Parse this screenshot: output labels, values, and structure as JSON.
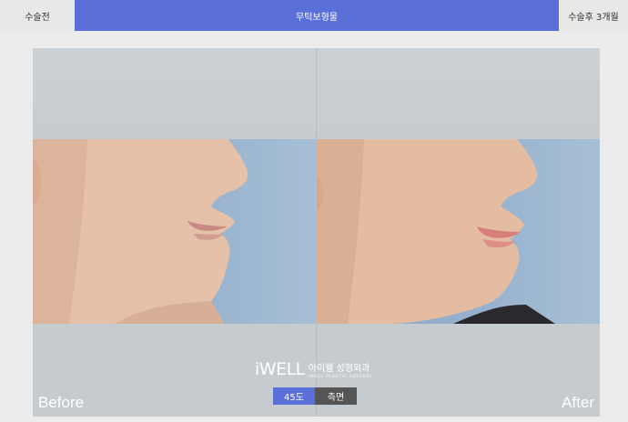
{
  "tabs": {
    "before": "수술전",
    "procedure": "무턱보형물",
    "after": "수술후 3개월"
  },
  "photo": {
    "label_before": "Before",
    "label_after": "After"
  },
  "logo": {
    "mark": "iWELL",
    "korean": "아이웰 성형외과",
    "english": "IWELL PLASTIC SURGERY"
  },
  "view_toggle": {
    "angle_45": "45도",
    "side": "측면"
  }
}
